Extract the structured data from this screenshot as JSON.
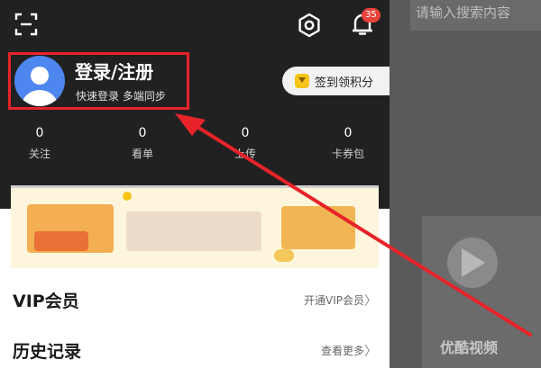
{
  "background": {
    "search_placeholder": "请输入搜索内容",
    "card_label": "优酷视频"
  },
  "header": {
    "notification_count": "35"
  },
  "user": {
    "login_title": "登录/注册",
    "login_subtitle": "快速登录 多端同步"
  },
  "checkin": {
    "label": "签到领积分"
  },
  "stats": [
    {
      "count": "0",
      "label": "关注"
    },
    {
      "count": "0",
      "label": "看单"
    },
    {
      "count": "0",
      "label": "上传"
    },
    {
      "count": "0",
      "label": "卡券包"
    }
  ],
  "menu": {
    "vip": {
      "title": "VIP会员",
      "action": "开通VIP会员"
    },
    "history": {
      "title": "历史记录",
      "action": "查看更多"
    }
  },
  "colors": {
    "highlight": "#e8232a",
    "arrow": "#e8232a",
    "badge": "#e8433a",
    "avatar": "#4e86f0",
    "checkin_icon": "#f5c518"
  }
}
